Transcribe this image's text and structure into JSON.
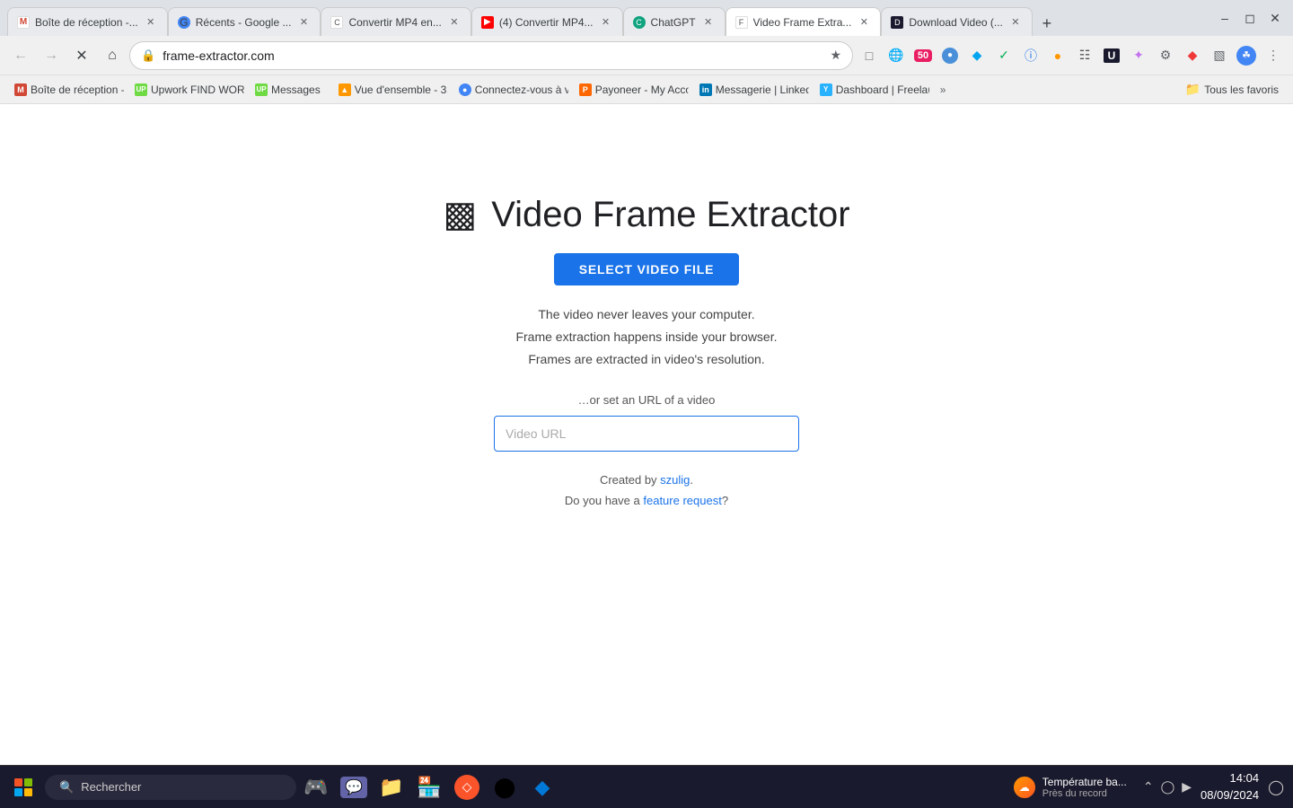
{
  "browser": {
    "tabs": [
      {
        "id": "gmail",
        "label": "Boîte de réception -...",
        "favicon": "M",
        "favicon_class": "fav-gmail",
        "active": false
      },
      {
        "id": "google",
        "label": "Récents - Google ...",
        "favicon": "G",
        "favicon_class": "fav-google",
        "active": false
      },
      {
        "id": "convertir-mp4",
        "label": "Convertir MP4 en...",
        "favicon": "C",
        "favicon_class": "fav-convert",
        "active": false
      },
      {
        "id": "youtube-mp4",
        "label": "(4) Convertir MP4...",
        "favicon": "▶",
        "favicon_class": "fav-youtube",
        "active": false
      },
      {
        "id": "chatgpt",
        "label": "ChatGPT",
        "favicon": "C",
        "favicon_class": "fav-chatgpt",
        "active": false
      },
      {
        "id": "video-frame",
        "label": "Video Frame Extra...",
        "favicon": "F",
        "favicon_class": "fav-frame",
        "active": true
      },
      {
        "id": "download-video",
        "label": "Download Video (...",
        "favicon": "D",
        "favicon_class": "fav-download",
        "active": false
      }
    ],
    "address": "frame-extractor.com",
    "bookmarks": [
      {
        "label": "Boîte de réception -...",
        "favicon_color": "#d14836"
      },
      {
        "label": "Upwork FIND WORK",
        "favicon_color": "#6fda44"
      },
      {
        "label": "Messages",
        "favicon_color": "#6fda44"
      },
      {
        "label": "Vue d'ensemble - 3...",
        "favicon_color": "#ff9800"
      },
      {
        "label": "Connectez-vous à v...",
        "favicon_color": "#4285f4"
      },
      {
        "label": "Payoneer - My Acco...",
        "favicon_color": "#ff6600"
      },
      {
        "label": "Messagerie | LinkedIn",
        "favicon_color": "#0077b5"
      },
      {
        "label": "Dashboard | Freelan...",
        "favicon_color": "#29b2fe"
      }
    ],
    "bookmarks_more": "»",
    "bookmarks_folder": "Tous les favoris"
  },
  "page": {
    "title": "Video Frame Extractor",
    "select_btn": "SELECT VIDEO FILE",
    "info_line1": "The video never leaves your computer.",
    "info_line2": "Frame extraction happens inside your browser.",
    "info_line3": "Frames are extracted in video's resolution.",
    "url_label": "…or set an URL of a video",
    "url_placeholder": "Video URL",
    "credits_text": "Created by ",
    "credits_author": "szulig",
    "credits_question": "Do you have a ",
    "credits_link": "feature request",
    "credits_end": "?"
  },
  "taskbar": {
    "notification_title": "Température ba...",
    "notification_subtitle": "Près du record",
    "search_placeholder": "Rechercher",
    "clock_time": "14:04",
    "clock_date": "08/09/2024"
  }
}
